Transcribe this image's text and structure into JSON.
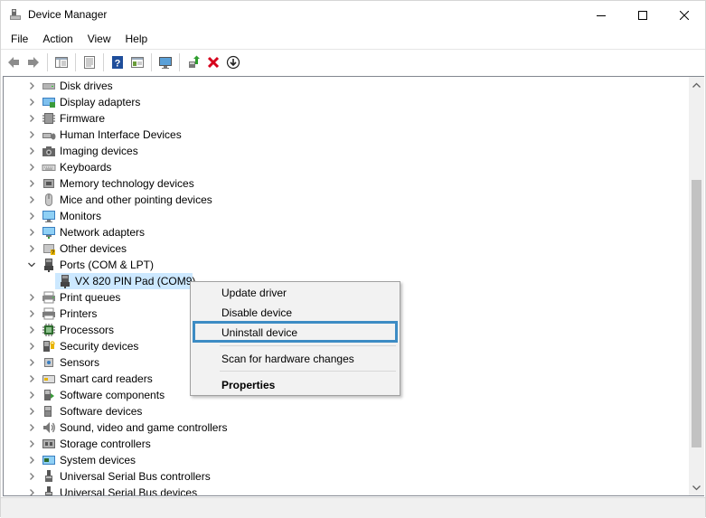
{
  "window": {
    "title": "Device Manager"
  },
  "menu": [
    "File",
    "Action",
    "View",
    "Help"
  ],
  "toolbar": {
    "buttons": [
      "back-icon",
      "forward-icon",
      "show-hide-console-tree-icon",
      "properties-icon",
      "help-icon",
      "view-icon",
      "scan-hardware-icon",
      "update-driver-icon",
      "uninstall-icon",
      "download-icon"
    ]
  },
  "tree": {
    "nodes": [
      {
        "label": "Disk drives",
        "icon": "disk-drive-icon",
        "expanded": false
      },
      {
        "label": "Display adapters",
        "icon": "display-adapter-icon",
        "expanded": false
      },
      {
        "label": "Firmware",
        "icon": "firmware-icon",
        "expanded": false
      },
      {
        "label": "Human Interface Devices",
        "icon": "hid-icon",
        "expanded": false
      },
      {
        "label": "Imaging devices",
        "icon": "camera-icon",
        "expanded": false
      },
      {
        "label": "Keyboards",
        "icon": "keyboard-icon",
        "expanded": false
      },
      {
        "label": "Memory technology devices",
        "icon": "memory-icon",
        "expanded": false
      },
      {
        "label": "Mice and other pointing devices",
        "icon": "mouse-icon",
        "expanded": false
      },
      {
        "label": "Monitors",
        "icon": "monitor-icon",
        "expanded": false
      },
      {
        "label": "Network adapters",
        "icon": "network-icon",
        "expanded": false
      },
      {
        "label": "Other devices",
        "icon": "other-device-icon",
        "expanded": false
      },
      {
        "label": "Ports (COM & LPT)",
        "icon": "port-icon",
        "expanded": true
      },
      {
        "label": "VX 820 PIN Pad (COM9)",
        "icon": "port-icon",
        "child": true,
        "selected": true
      },
      {
        "label": "Print queues",
        "icon": "print-queue-icon",
        "expanded": false
      },
      {
        "label": "Printers",
        "icon": "printer-icon",
        "expanded": false
      },
      {
        "label": "Processors",
        "icon": "processor-icon",
        "expanded": false
      },
      {
        "label": "Security devices",
        "icon": "security-icon",
        "expanded": false
      },
      {
        "label": "Sensors",
        "icon": "sensor-icon",
        "expanded": false
      },
      {
        "label": "Smart card readers",
        "icon": "smart-card-icon",
        "expanded": false
      },
      {
        "label": "Software components",
        "icon": "software-component-icon",
        "expanded": false
      },
      {
        "label": "Software devices",
        "icon": "software-device-icon",
        "expanded": false
      },
      {
        "label": "Sound, video and game controllers",
        "icon": "sound-icon",
        "expanded": false
      },
      {
        "label": "Storage controllers",
        "icon": "storage-icon",
        "expanded": false
      },
      {
        "label": "System devices",
        "icon": "system-device-icon",
        "expanded": false
      },
      {
        "label": "Universal Serial Bus controllers",
        "icon": "usb-icon",
        "expanded": false
      },
      {
        "label": "Universal Serial Bus devices",
        "icon": "usb-icon",
        "expanded": false
      }
    ]
  },
  "context_menu": {
    "items": [
      "Update driver",
      "Disable device",
      "Uninstall device",
      "Scan for hardware changes",
      "Properties"
    ],
    "highlighted": "Uninstall device",
    "default_item": "Properties"
  },
  "colors": {
    "selection": "#cce8ff",
    "highlight_border": "#3d8cc4",
    "uninstall_red": "#d6001c",
    "help_blue": "#1f4e9b"
  }
}
